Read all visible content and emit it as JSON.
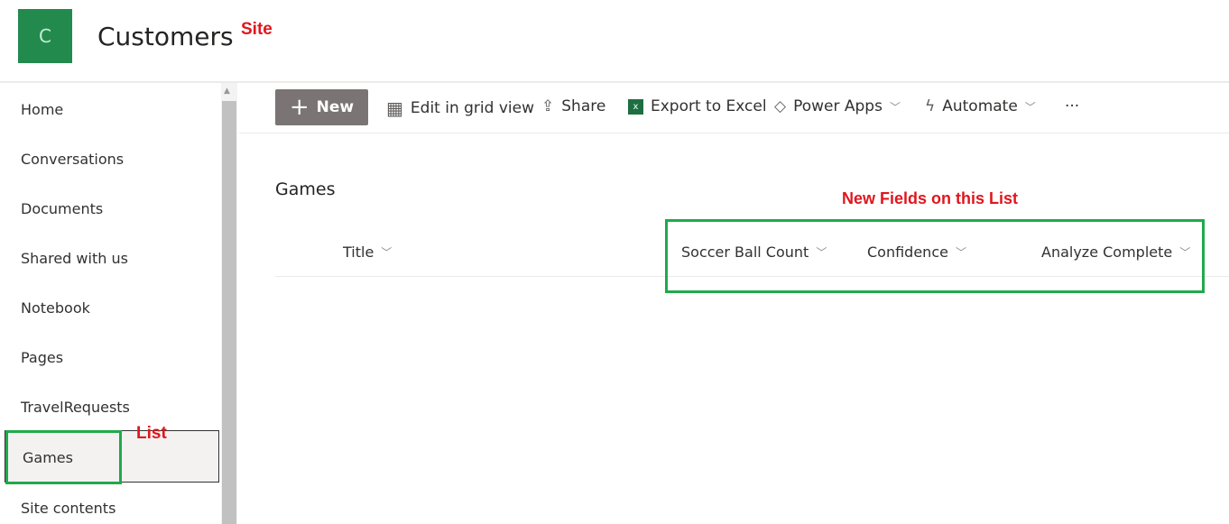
{
  "site": {
    "logo_letter": "C",
    "title": "Customers",
    "annotation": "Site"
  },
  "nav": {
    "items": [
      "Home",
      "Conversations",
      "Documents",
      "Shared with us",
      "Notebook",
      "Pages",
      "TravelRequests",
      "Games",
      "Site contents"
    ],
    "selected": "Games",
    "annotation": "List"
  },
  "toolbar": {
    "new": "New",
    "edit_grid": "Edit in grid view",
    "share": "Share",
    "export": "Export to Excel",
    "power_apps": "Power Apps",
    "automate": "Automate",
    "more": "···"
  },
  "list": {
    "title": "Games",
    "annotation": "New Fields on this List",
    "columns": [
      "Title",
      "Soccer Ball Count",
      "Confidence",
      "Analyze Complete"
    ]
  },
  "colors": {
    "accent_green": "#228a4d",
    "annotation_red": "#e0161e",
    "highlight_box": "#1faa4a"
  }
}
